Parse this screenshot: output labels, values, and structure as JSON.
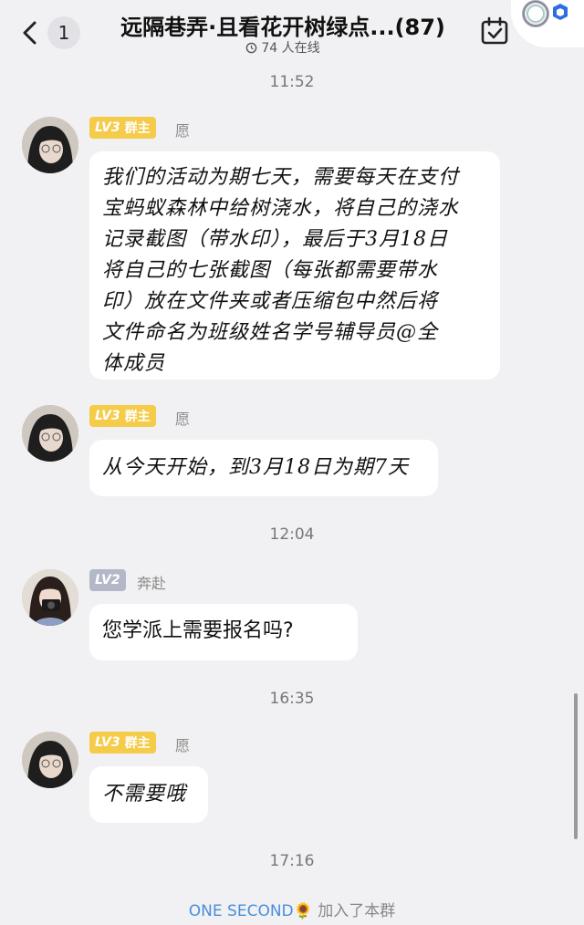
{
  "header": {
    "back_count": "1",
    "title": "远隔巷弄·且看花开树绿点...(87)",
    "online": "74 人在线"
  },
  "messages": [
    {
      "time": "11:52",
      "badge_level": "LV3",
      "badge_role": "群主",
      "badge_color": "#f5cb4a",
      "name": "愿",
      "lines": [
        "我们的活动为期七天，需要每天在支付",
        "宝蚂蚁森林中给树浇水，将自己的浇水",
        "记录截图（带水印），最后于3月18日",
        "将自己的七张截图（每张都需要带水",
        "印）放在文件夹或者压缩包中然后将",
        "文件命名为班级姓名学号辅导员@全",
        "体成员"
      ]
    },
    {
      "badge_level": "LV3",
      "badge_role": "群主",
      "name": "愿",
      "text": "从今天开始，到3月18日为期7天"
    },
    {
      "time": "12:04",
      "badge_level": "LV2",
      "badge_color": "#b3b8c8",
      "name": "奔赴",
      "text": "您学派上需要报名吗?"
    },
    {
      "time": "16:35",
      "badge_level": "LV3",
      "badge_role": "群主",
      "name": "愿",
      "text": "不需要哦"
    }
  ],
  "footer": {
    "time": "17:16",
    "joiner": "ONE SECOND🌻",
    "join_text": "加入了本群"
  }
}
